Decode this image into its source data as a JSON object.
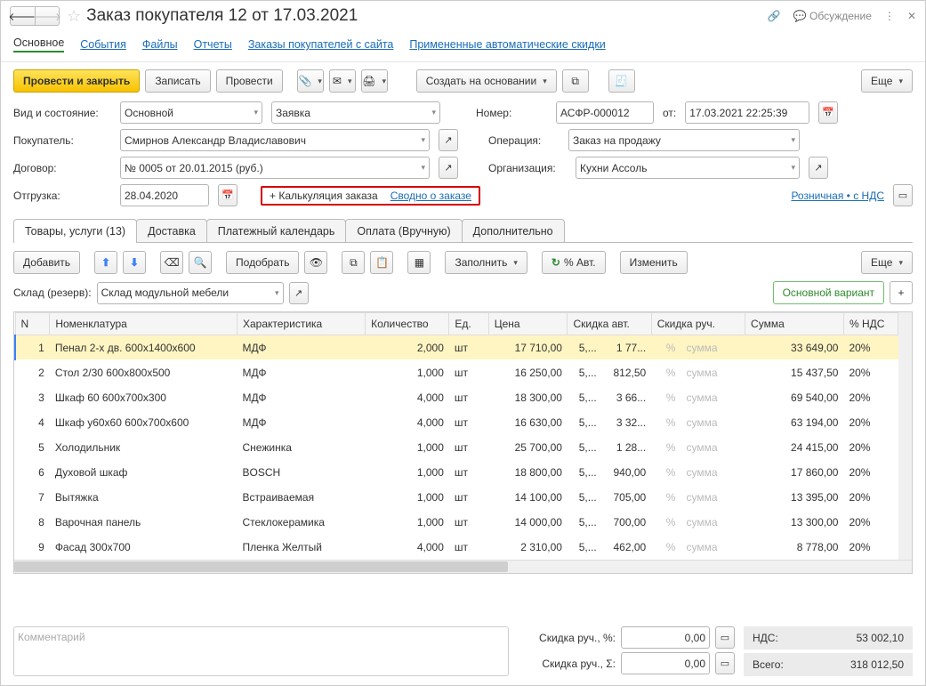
{
  "header": {
    "title": "Заказ покупателя 12 от 17.03.2021",
    "discuss": "Обсуждение"
  },
  "nav": [
    "Основное",
    "События",
    "Файлы",
    "Отчеты",
    "Заказы покупателей с сайта",
    "Примененные автоматические скидки"
  ],
  "toolbar": {
    "post_close": "Провести и закрыть",
    "save": "Записать",
    "post": "Провести",
    "create_based": "Создать на основании",
    "more": "Еще"
  },
  "form": {
    "kind_label": "Вид и состояние:",
    "kind": "Основной",
    "status": "Заявка",
    "number_label": "Номер:",
    "number": "АСФР-000012",
    "from_label": "от:",
    "date": "17.03.2021 22:25:39",
    "buyer_label": "Покупатель:",
    "buyer": "Смирнов Александр Владиславович",
    "operation_label": "Операция:",
    "operation": "Заказ на продажу",
    "contract_label": "Договор:",
    "contract": "№ 0005 от 20.01.2015 (руб.)",
    "org_label": "Организация:",
    "org": "Кухни Ассоль",
    "ship_label": "Отгрузка:",
    "ship_date": "28.04.2020",
    "calc": "+ Калькуляция заказа",
    "summary": "Сводно о заказе",
    "retail": "Розничная • с НДС"
  },
  "tabs2": [
    "Товары, услуги (13)",
    "Доставка",
    "Платежный календарь",
    "Оплата (Вручную)",
    "Дополнительно"
  ],
  "toolbar2": {
    "add": "Добавить",
    "pick": "Подобрать",
    "fill": "Заполнить",
    "auto": "% Авт.",
    "edit": "Изменить",
    "more": "Еще",
    "stock_label": "Склад (резерв):",
    "stock": "Склад модульной мебели",
    "variant": "Основной вариант"
  },
  "columns": [
    "N",
    "Номенклатура",
    "Характеристика",
    "Количество",
    "Ед.",
    "Цена",
    "Скидка авт.",
    "",
    "Скидка руч.",
    "",
    "Сумма",
    "% НДС"
  ],
  "rows": [
    {
      "n": "1",
      "name": "Пенал 2-х дв. 600х1400х600",
      "char": "МДФ",
      "qty": "2,000",
      "unit": "шт",
      "price": "17 710,00",
      "da": "5,...",
      "da2": "1 77...",
      "drp": "%",
      "drs": "сумма",
      "sum": "33 649,00",
      "vat": "20%"
    },
    {
      "n": "2",
      "name": "Стол 2/30 600х800х500",
      "char": "МДФ",
      "qty": "1,000",
      "unit": "шт",
      "price": "16 250,00",
      "da": "5,...",
      "da2": "812,50",
      "drp": "%",
      "drs": "сумма",
      "sum": "15 437,50",
      "vat": "20%"
    },
    {
      "n": "3",
      "name": "Шкаф 60 600х700х300",
      "char": "МДФ",
      "qty": "4,000",
      "unit": "шт",
      "price": "18 300,00",
      "da": "5,...",
      "da2": "3 66...",
      "drp": "%",
      "drs": "сумма",
      "sum": "69 540,00",
      "vat": "20%"
    },
    {
      "n": "4",
      "name": "Шкаф у60х60 600х700х600",
      "char": "МДФ",
      "qty": "4,000",
      "unit": "шт",
      "price": "16 630,00",
      "da": "5,...",
      "da2": "3 32...",
      "drp": "%",
      "drs": "сумма",
      "sum": "63 194,00",
      "vat": "20%"
    },
    {
      "n": "5",
      "name": "Холодильник",
      "char": "Снежинка",
      "qty": "1,000",
      "unit": "шт",
      "price": "25 700,00",
      "da": "5,...",
      "da2": "1 28...",
      "drp": "%",
      "drs": "сумма",
      "sum": "24 415,00",
      "vat": "20%"
    },
    {
      "n": "6",
      "name": "Духовой шкаф",
      "char": "BOSCH",
      "qty": "1,000",
      "unit": "шт",
      "price": "18 800,00",
      "da": "5,...",
      "da2": "940,00",
      "drp": "%",
      "drs": "сумма",
      "sum": "17 860,00",
      "vat": "20%"
    },
    {
      "n": "7",
      "name": "Вытяжка",
      "char": "Встраиваемая",
      "qty": "1,000",
      "unit": "шт",
      "price": "14 100,00",
      "da": "5,...",
      "da2": "705,00",
      "drp": "%",
      "drs": "сумма",
      "sum": "13 395,00",
      "vat": "20%"
    },
    {
      "n": "8",
      "name": "Варочная панель",
      "char": "Стеклокерамика",
      "qty": "1,000",
      "unit": "шт",
      "price": "14 000,00",
      "da": "5,...",
      "da2": "700,00",
      "drp": "%",
      "drs": "сумма",
      "sum": "13 300,00",
      "vat": "20%"
    },
    {
      "n": "9",
      "name": "Фасад 300х700",
      "char": "Пленка Желтый",
      "qty": "4,000",
      "unit": "шт",
      "price": "2 310,00",
      "da": "5,...",
      "da2": "462,00",
      "drp": "%",
      "drs": "сумма",
      "sum": "8 778,00",
      "vat": "20%"
    }
  ],
  "footer": {
    "comment_ph": "Комментарий",
    "disc_pct_lbl": "Скидка руч., %:",
    "disc_pct": "0,00",
    "disc_sum_lbl": "Скидка руч., Σ:",
    "disc_sum": "0,00",
    "nds_lbl": "НДС:",
    "nds": "53 002,10",
    "total_lbl": "Всего:",
    "total": "318 012,50"
  }
}
